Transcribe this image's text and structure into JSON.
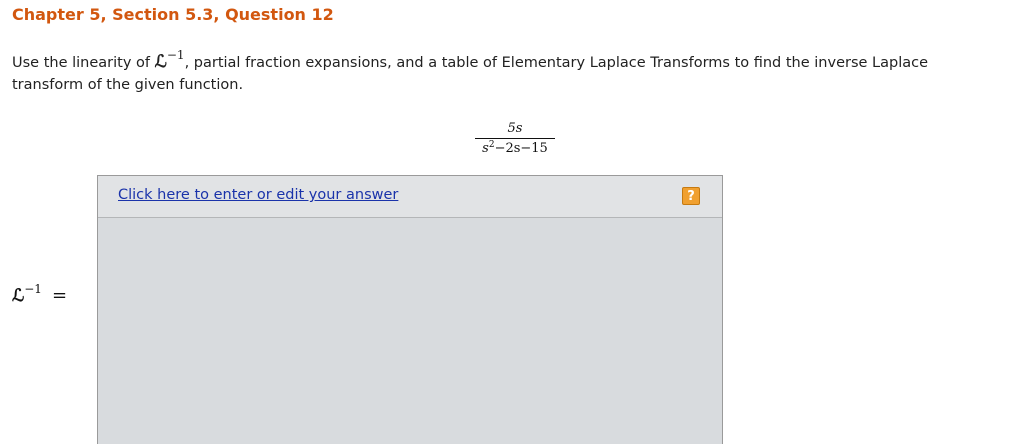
{
  "heading": "Chapter 5, Section 5.3, Question 12",
  "question": {
    "before": "Use the linearity of ",
    "operator": "ℒ",
    "exponent": "−1",
    "after": ", partial fraction expansions, and a table of Elementary Laplace Transforms to find the inverse Laplace transform of the given function."
  },
  "fraction": {
    "numerator": "5s",
    "denominator": {
      "base": "s",
      "power": "2",
      "rest": "−2s−15"
    }
  },
  "answer": {
    "link_text": "Click here to enter or edit your answer",
    "help_label": "?"
  },
  "lhs": {
    "operator": "ℒ",
    "exponent": "−1",
    "equals": "="
  },
  "colors": {
    "heading": "#d2570f",
    "link": "#1a33aa",
    "help_button": "#f0a030",
    "answer_area": "#d8dbde"
  }
}
